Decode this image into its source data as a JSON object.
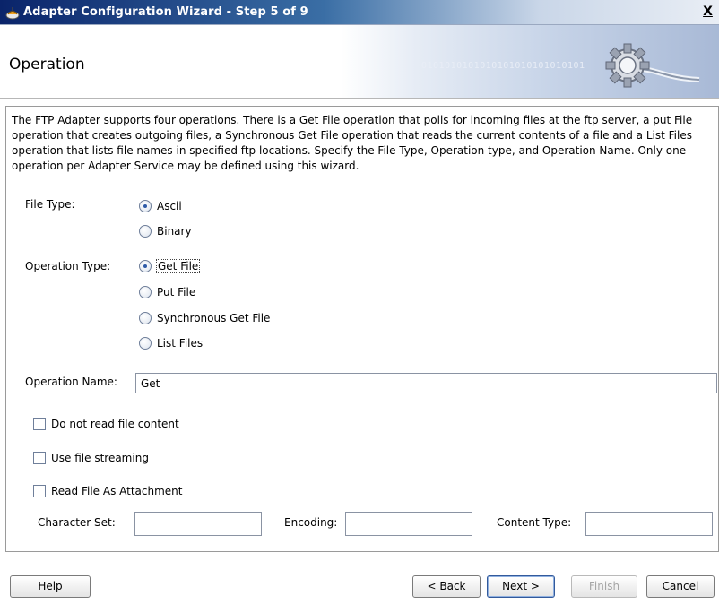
{
  "window": {
    "title": "Adapter Configuration Wizard - Step 5 of 9",
    "close_label": "X"
  },
  "header": {
    "heading": "Operation",
    "banner_text": "0101010101010101010101010101"
  },
  "description": "The FTP Adapter supports four operations.  There is a Get File operation that polls for incoming files at the ftp server, a put File operation that creates outgoing files, a Synchronous Get File operation that reads the current contents of a file and a List Files operation that lists file names in specified ftp locations.  Specify the File Type, Operation type, and Operation Name.  Only one operation per Adapter Service may be defined using this wizard.",
  "file_type": {
    "label": "File Type:",
    "options": [
      {
        "label": "Ascii",
        "selected": true
      },
      {
        "label": "Binary",
        "selected": false
      }
    ]
  },
  "operation_type": {
    "label": "Operation Type:",
    "options": [
      {
        "label": "Get File",
        "selected": true
      },
      {
        "label": "Put File",
        "selected": false
      },
      {
        "label": "Synchronous Get File",
        "selected": false
      },
      {
        "label": "List Files",
        "selected": false
      }
    ]
  },
  "operation_name": {
    "label": "Operation Name:",
    "value": "Get"
  },
  "checkboxes": [
    {
      "label": "Do not read file content",
      "checked": false
    },
    {
      "label": "Use file streaming",
      "checked": false
    },
    {
      "label": "Read File As Attachment",
      "checked": false
    }
  ],
  "attachment": {
    "character_set_label": "Character Set:",
    "character_set_value": "",
    "encoding_label": "Encoding:",
    "encoding_value": "",
    "content_type_label": "Content Type:",
    "content_type_value": ""
  },
  "buttons": {
    "help": "Help",
    "back": "< Back",
    "next": "Next >",
    "finish": "Finish",
    "cancel": "Cancel"
  }
}
